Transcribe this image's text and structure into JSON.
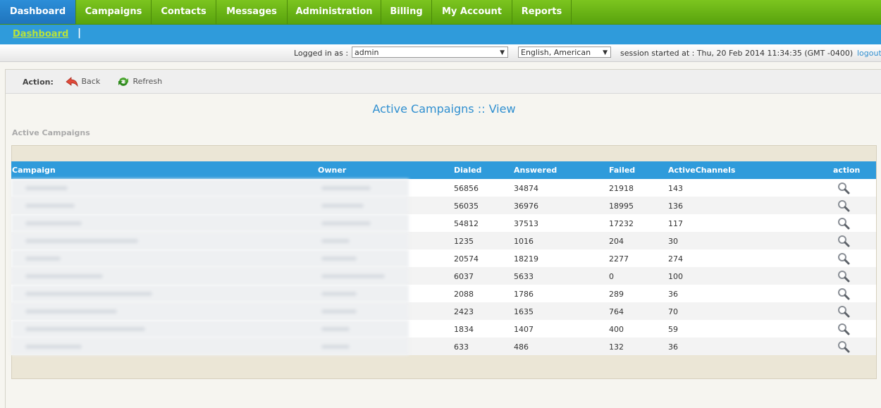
{
  "top_menu": {
    "tabs": [
      {
        "label": "Dashboard",
        "active": true
      },
      {
        "label": "Campaigns",
        "active": false
      },
      {
        "label": "Contacts",
        "active": false
      },
      {
        "label": "Messages",
        "active": false
      },
      {
        "label": "Administration",
        "active": false
      },
      {
        "label": "Billing",
        "active": false
      },
      {
        "label": "My Account",
        "active": false
      },
      {
        "label": "Reports",
        "active": false
      }
    ]
  },
  "sub_menu": {
    "active_item": "Dashboard",
    "separator": "|"
  },
  "info_bar": {
    "logged_in_label": "Logged in as :",
    "user_select": "admin",
    "language_select": "English, American",
    "session_text": "session started at : Thu, 20 Feb 2014 11:34:35 (GMT -0400)",
    "logout_label": "logout"
  },
  "action_bar": {
    "label": "Action:",
    "back_label": "Back",
    "refresh_label": "Refresh"
  },
  "page_title": "Active Campaigns :: View",
  "section_title": "Active Campaigns",
  "table": {
    "columns": [
      "Campaign",
      "Owner",
      "Dialed",
      "Answered",
      "Failed",
      "ActiveChannels",
      "action"
    ],
    "rows": [
      {
        "dialed": "56856",
        "answered": "34874",
        "failed": "21918",
        "active": "143"
      },
      {
        "dialed": "56035",
        "answered": "36976",
        "failed": "18995",
        "active": "136"
      },
      {
        "dialed": "54812",
        "answered": "37513",
        "failed": "17232",
        "active": "117"
      },
      {
        "dialed": "1235",
        "answered": "1016",
        "failed": "204",
        "active": "30"
      },
      {
        "dialed": "20574",
        "answered": "18219",
        "failed": "2277",
        "active": "274"
      },
      {
        "dialed": "6037",
        "answered": "5633",
        "failed": "0",
        "active": "100"
      },
      {
        "dialed": "2088",
        "answered": "1786",
        "failed": "289",
        "active": "36"
      },
      {
        "dialed": "2423",
        "answered": "1635",
        "failed": "764",
        "active": "70"
      },
      {
        "dialed": "1834",
        "answered": "1407",
        "failed": "400",
        "active": "59"
      },
      {
        "dialed": "633",
        "answered": "486",
        "failed": "132",
        "active": "36"
      }
    ]
  },
  "colors": {
    "nav_green": "#6cb716",
    "nav_active_blue": "#2181c8",
    "header_blue": "#2f9bdb",
    "link_blue": "#2f8fd0"
  }
}
